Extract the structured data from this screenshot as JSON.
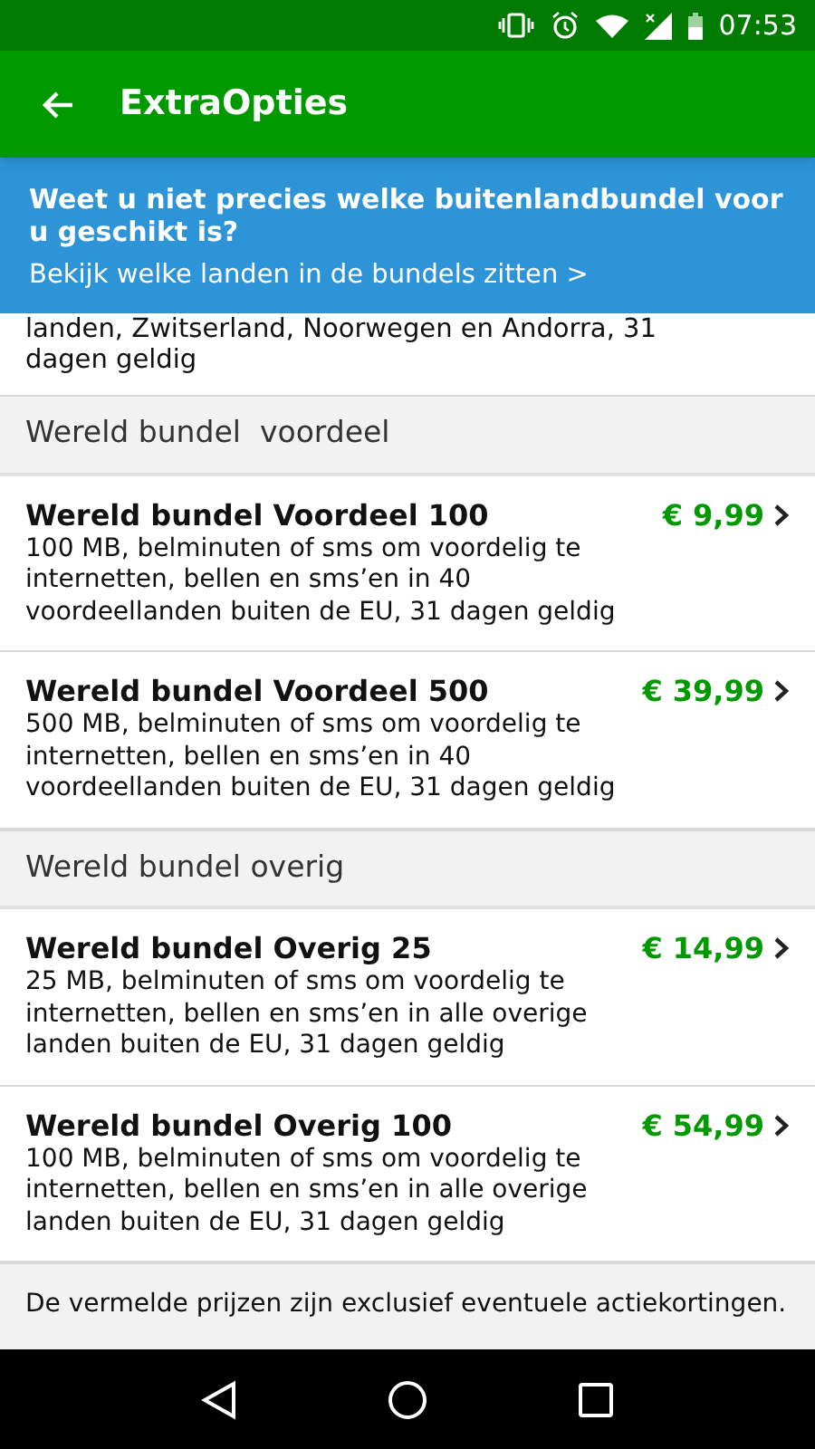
{
  "status_bar": {
    "time": "07:53"
  },
  "app_bar": {
    "title": "ExtraOpties"
  },
  "banner": {
    "question": "Weet u niet precies welke buitenlandbundel voor u geschikt is?",
    "link": "Bekijk welke landen in de bundels zitten >"
  },
  "partial_item": {
    "description": "landen, Zwitserland, Noorwegen en Andorra, 31 dagen geldig"
  },
  "sections": [
    {
      "header": "Wereld bundel  voordeel",
      "items": [
        {
          "title": "Wereld bundel Voordeel 100",
          "price": "€ 9,99",
          "description": "100 MB, belminuten of sms om voordelig te internetten, bellen en sms’en in 40 voordeellanden buiten de EU, 31 dagen geldig"
        },
        {
          "title": "Wereld bundel Voordeel 500",
          "price": "€ 39,99",
          "description": "500 MB, belminuten of sms om voordelig te internetten, bellen en sms’en in 40 voordeellanden buiten de EU, 31 dagen geldig"
        }
      ]
    },
    {
      "header": "Wereld bundel overig",
      "items": [
        {
          "title": "Wereld bundel Overig 25",
          "price": "€ 14,99",
          "description": "25 MB, belminuten of sms om voordelig te internetten, bellen en sms’en in alle overige landen buiten de EU, 31 dagen geldig"
        },
        {
          "title": "Wereld bundel Overig 100",
          "price": "€ 54,99",
          "description": "100 MB, belminuten of sms om voordelig te internetten, bellen en sms’en in alle overige landen buiten de EU, 31 dagen geldig"
        }
      ]
    }
  ],
  "footer": "De vermelde prijzen zijn exclusief eventuele actiekortingen."
}
